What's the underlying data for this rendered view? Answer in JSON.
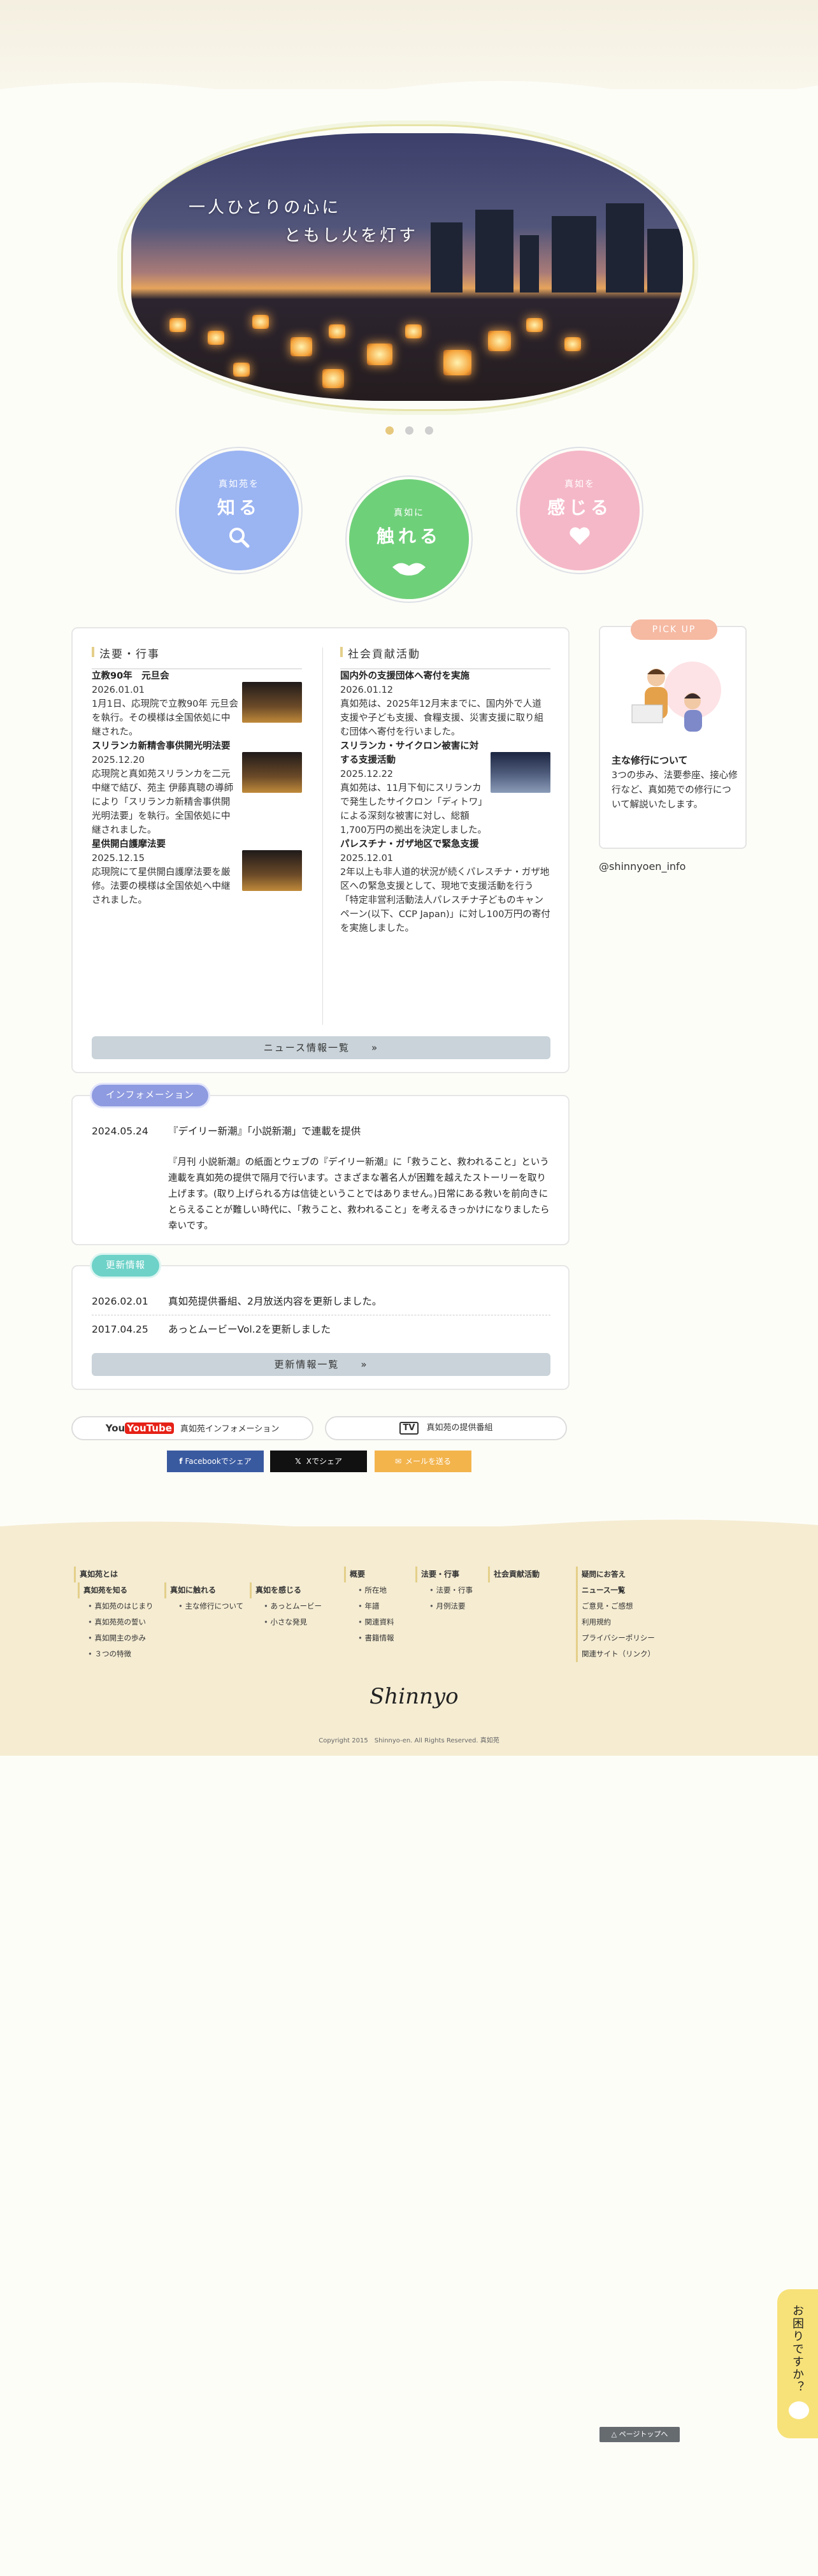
{
  "hero": {
    "line1": "一人ひとりの心に",
    "line2": "ともし火を灯す"
  },
  "circles": [
    {
      "small": "真如苑を",
      "big": "知る",
      "icon": "search-icon",
      "color": "#9bb4f2"
    },
    {
      "small": "真如に",
      "big": "触れる",
      "icon": "hands-icon",
      "color": "#6fd07a"
    },
    {
      "small": "真如を",
      "big": "感じる",
      "icon": "heart-icon",
      "color": "#f5b8c8"
    }
  ],
  "news": {
    "left_title": "法要・行事",
    "right_title": "社会貢献活動",
    "left": [
      {
        "title": "立教90年　元旦会",
        "date": "2026.01.01",
        "text": "1月1日、応現院で立教90年 元旦会を執行。その模様は全国依処に中継された。"
      },
      {
        "title": "スリランカ新精舎事供開光明法要",
        "date": "2025.12.20",
        "text": "応現院と真如苑スリランカを二元中継で結び、苑主 伊藤真聰の導師により「スリランカ新精舎事供開光明法要」を執行。全国依処に中継されました。"
      },
      {
        "title": "星供開白護摩法要",
        "date": "2025.12.15",
        "text": "応現院にて星供開白護摩法要を厳修。法要の模様は全国依処へ中継されました。"
      }
    ],
    "right": [
      {
        "title": "国内外の支援団体へ寄付を実施",
        "date": "2026.01.12",
        "text": "真如苑は、2025年12月末までに、国内外で人道支援や子ども支援、食糧支援、災害支援に取り組む団体へ寄付を行いました。"
      },
      {
        "title": "スリランカ・サイクロン被害に対する支援活動",
        "date": "2025.12.22",
        "text": "真如苑は、11月下旬にスリランカで発生したサイクロン「ディトワ」による深刻な被害に対し、総額1,700万円の拠出を決定しました。"
      },
      {
        "title": "パレスチナ・ガザ地区で緊急支援",
        "date": "2025.12.01",
        "text": "2年以上も非人道的状況が続くパレスチナ・ガザ地区への緊急支援として、現地で支援活動を行う「特定非営利活動法人パレスチナ子どものキャンペーン(以下、CCP Japan)」に対し100万円の寄付を実施しました。"
      }
    ],
    "more": "ニュース情報一覧　　»"
  },
  "information": {
    "label": "インフォメーション",
    "date": "2024.05.24",
    "title": "『デイリー新潮』「小説新潮」で連載を提供",
    "body": "『月刊 小説新潮』の紙面とウェブの『デイリー新潮』に「救うこと、救われること」という連載を真如苑の提供で隔月で行います。さまざまな著名人が困難を越えたストーリーを取り上げます。(取り上げられる方は信徒ということではありません。)日常にある救いを前向きにとらえることが難しい時代に、「救うこと、救われること」を考えるきっかけになりましたら幸いです。"
  },
  "updates": {
    "label": "更新情報",
    "items": [
      {
        "date": "2026.02.01",
        "text": "真如苑提供番組、2月放送内容を更新しました。"
      },
      {
        "date": "2017.04.25",
        "text": "あっとムービーVol.2を更新しました"
      }
    ],
    "more": "更新情報一覧　　»"
  },
  "pickup": {
    "label": "PICK UP",
    "title": "主な修行について",
    "text": "3つの歩み、法要参座、接心修行など、真如苑での修行について解説いたします。",
    "instagram": "@shinnyoen_info"
  },
  "links": {
    "youtube_brand": "YouTube",
    "youtube": "真如苑インフォメーション",
    "tv_brand": "TV",
    "tv": "真如苑の提供番組",
    "facebook": "Facebookでシェア",
    "x": "Xでシェア",
    "mail": "メールを送る"
  },
  "footer": {
    "c1": {
      "head": "真如苑とは",
      "sub": "真如苑を知る",
      "items": [
        "真如苑のはじまり",
        "真如苑苑の誓い",
        "真如開主の歩み",
        "３つの特徴"
      ]
    },
    "c2": {
      "sub": "真如に触れる",
      "items": [
        "主な修行について"
      ]
    },
    "c3": {
      "sub": "真如を感じる",
      "items": [
        "あっとムービー",
        "小さな発見"
      ]
    },
    "c4": {
      "head": "概要",
      "items": [
        "所在地",
        "年譜",
        "関連資料",
        "書籍情報"
      ]
    },
    "c5": {
      "head": "法要・行事",
      "items": [
        "法要・行事",
        "月例法要"
      ]
    },
    "c6": {
      "head": "社会貢献活動"
    },
    "c7": {
      "items": [
        "疑問にお答え",
        "ニュース一覧",
        "ご意見・ご感想",
        "利用規約",
        "プライバシーポリシー",
        "関連サイト（リンク）"
      ]
    },
    "logo": "Shinnyo",
    "copyright": "Copyright 2015　Shinnyo-en. All Rights Reserved. 真如苑"
  },
  "pagetop": "△ ページトップへ",
  "help": "お困りですか？"
}
